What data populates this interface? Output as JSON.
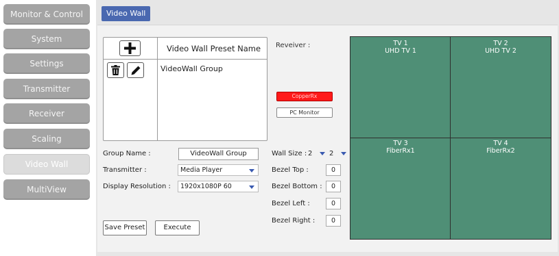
{
  "sidebar": {
    "items": [
      {
        "label": "Monitor & Control",
        "active": false
      },
      {
        "label": "System",
        "active": false
      },
      {
        "label": "Settings",
        "active": false
      },
      {
        "label": "Transmitter",
        "active": false
      },
      {
        "label": "Receiver",
        "active": false
      },
      {
        "label": "Scaling",
        "active": false
      },
      {
        "label": "Video Wall",
        "active": true
      },
      {
        "label": "MultiView",
        "active": false
      }
    ]
  },
  "page": {
    "title": "Video Wall"
  },
  "preset": {
    "header": "Video Wall Preset Name",
    "items": [
      "VideoWall Group"
    ],
    "icons": {
      "add": "plus-icon",
      "delete": "trash-icon",
      "edit": "pencil-icon"
    }
  },
  "receiver": {
    "label": "Reveiver :",
    "buttons": [
      {
        "label": "CopperRx",
        "color": "#ff1a1a"
      },
      {
        "label": "PC Monitor",
        "color": "#ffffff"
      }
    ]
  },
  "form": {
    "group_name_label": "Group Name :",
    "group_name_value": "VideoWall Group",
    "transmitter_label": "Transmitter :",
    "transmitter_value": "Media Player",
    "resolution_label": "Display Resolution :",
    "resolution_value": "1920x1080P 60",
    "wall_size_label": "Wall Size :",
    "wall_size_cols": "2",
    "wall_size_rows": "2",
    "bezel_top_label": "Bezel Top :",
    "bezel_top_value": "0",
    "bezel_bottom_label": "Bezel Bottom :",
    "bezel_bottom_value": "0",
    "bezel_left_label": "Bezel Left :",
    "bezel_left_value": "0",
    "bezel_right_label": "Bezel Right :",
    "bezel_right_value": "0",
    "save_label": "Save Preset",
    "execute_label": "Execute"
  },
  "wall": {
    "color": "#4f8f76",
    "cells": [
      {
        "tv": "TV 1",
        "rx": "UHD TV 1"
      },
      {
        "tv": "TV 2",
        "rx": "UHD TV 2"
      },
      {
        "tv": "TV 3",
        "rx": "FiberRx1"
      },
      {
        "tv": "TV 4",
        "rx": "FiberRx2"
      }
    ]
  }
}
